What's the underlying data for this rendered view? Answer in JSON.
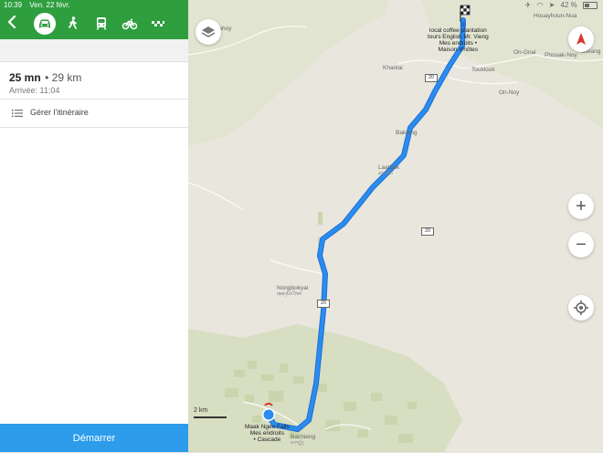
{
  "status": {
    "time": "10:39",
    "date": "Ven. 22 févr.",
    "battery_label": "42 %"
  },
  "panel": {
    "modes": [
      {
        "name": "car",
        "active": true
      },
      {
        "name": "walk",
        "active": false
      },
      {
        "name": "transit",
        "active": false
      },
      {
        "name": "bike",
        "active": false
      },
      {
        "name": "taxi",
        "active": false
      }
    ],
    "duration": "25 mn",
    "distance": "• 29 km",
    "arrival": "Arrivée: 11:04",
    "manage_label": "Gérer l'itinéraire",
    "start_label": "Démarrer"
  },
  "map": {
    "labels": {
      "tahoy": "...ahoy",
      "houayhoun": "Houayhoun-Nua",
      "onngai": "On-Gnai",
      "phouak": "Phouak-Noy",
      "sixiang": "Sixiang",
      "khanlai": "Khanlai",
      "touklouk": "Touklouk",
      "onnoy": "On-Noy",
      "bakieng": "Bakieng",
      "laatbok": "Laatbok",
      "laatbok_lao": "ລາດບົກ",
      "nongbokyai": "Nongbokyai",
      "nongbokyai_lao": "ໜອງບົກໃຫຍ່",
      "bachieng": "Bachieng",
      "bachieng_lao": "ບາຈຽງ"
    },
    "destination": {
      "line1": "local coffee plantation",
      "line2": "tours English Mr. Vieng",
      "line3": "Mes endroits •",
      "line4": "Maison d'hôtes"
    },
    "origin": {
      "line1": "Maak Ngeo Falls",
      "line2": "Mes endroits",
      "line3": "• Cascade"
    },
    "road_number": "20",
    "scale_label": "2 km",
    "zoom_in": "+",
    "zoom_out": "−"
  }
}
